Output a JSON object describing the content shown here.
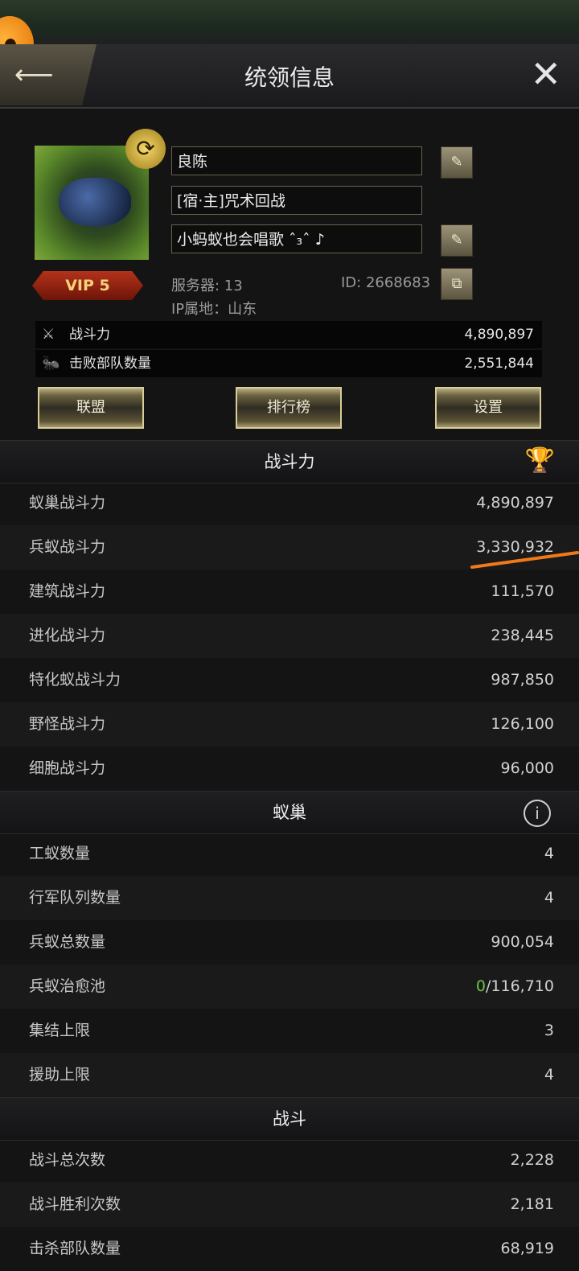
{
  "header": {
    "title": "统领信息"
  },
  "profile": {
    "name": "良陈",
    "alliance_title": "[宿·主]咒术回战",
    "signature": "小蚂蚁也会唱歌 ˆ₃ˆ ♪",
    "vip": "VIP 5",
    "server": "服务器: 13",
    "id": "ID: 2668683",
    "ip_location": "IP属地：山东"
  },
  "summary": [
    {
      "label": "战斗力",
      "value": "4,890,897",
      "icon": "crossed-swords-icon"
    },
    {
      "label": "击败部队数量",
      "value": "2,551,844",
      "icon": "ant-icon"
    }
  ],
  "buttons": {
    "alliance": "联盟",
    "ranking": "排行榜",
    "settings": "设置"
  },
  "sections": {
    "power": {
      "title": "战斗力",
      "rows": [
        {
          "label": "蚁巢战斗力",
          "value": "4,890,897"
        },
        {
          "label": "兵蚁战斗力",
          "value": "3,330,932"
        },
        {
          "label": "建筑战斗力",
          "value": "111,570"
        },
        {
          "label": "进化战斗力",
          "value": "238,445"
        },
        {
          "label": "特化蚁战斗力",
          "value": "987,850"
        },
        {
          "label": "野怪战斗力",
          "value": "126,100"
        },
        {
          "label": "细胞战斗力",
          "value": "96,000"
        }
      ]
    },
    "nest": {
      "title": "蚁巢",
      "rows": [
        {
          "label": "工蚁数量",
          "value": "4"
        },
        {
          "label": "行军队列数量",
          "value": "4"
        },
        {
          "label": "兵蚁总数量",
          "value": "900,054"
        },
        {
          "label": "兵蚁治愈池",
          "value_green": "0",
          "value": "/116,710"
        },
        {
          "label": "集结上限",
          "value": "3"
        },
        {
          "label": "援助上限",
          "value": "4"
        }
      ]
    },
    "battle": {
      "title": "战斗",
      "rows": [
        {
          "label": "战斗总次数",
          "value": "2,228"
        },
        {
          "label": "战斗胜利次数",
          "value": "2,181"
        },
        {
          "label": "击杀部队数量",
          "value": "68,919"
        }
      ]
    }
  },
  "colors": {
    "accent_gold": "#d7a23a",
    "vip_red": "#b3321b",
    "heal_green": "#6ec43f",
    "highlight_orange": "#f07a1a"
  }
}
